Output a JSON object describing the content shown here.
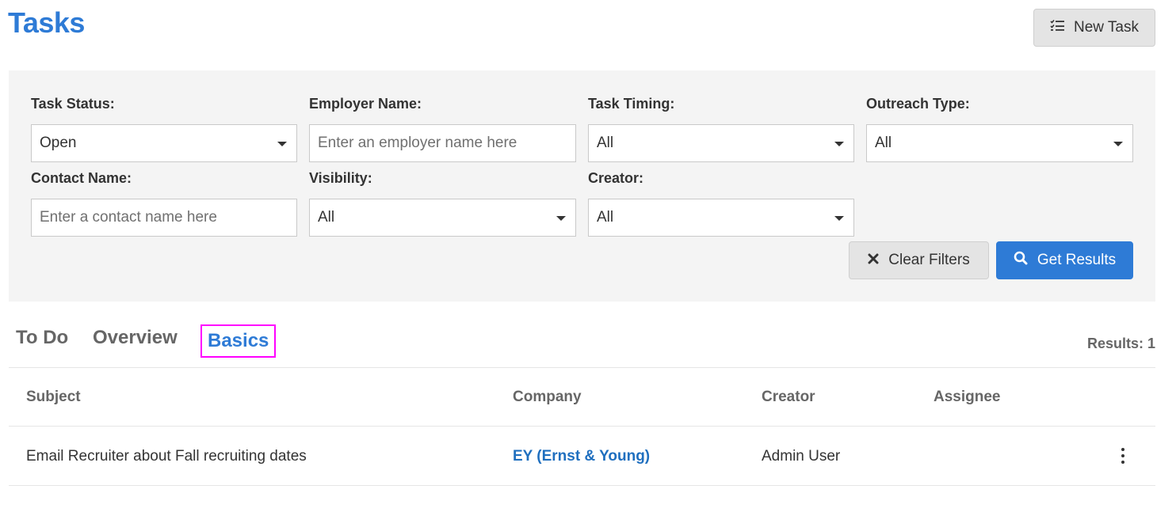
{
  "header": {
    "title": "Tasks",
    "new_task_label": "New Task"
  },
  "filters": {
    "task_status": {
      "label": "Task Status:",
      "value": "Open"
    },
    "employer_name": {
      "label": "Employer Name:",
      "placeholder": "Enter an employer name here"
    },
    "task_timing": {
      "label": "Task Timing:",
      "value": "All"
    },
    "outreach_type": {
      "label": "Outreach Type:",
      "value": "All"
    },
    "contact_name": {
      "label": "Contact Name:",
      "placeholder": "Enter a contact name here"
    },
    "visibility": {
      "label": "Visibility:",
      "value": "All"
    },
    "creator": {
      "label": "Creator:",
      "value": "All"
    },
    "clear_label": "Clear Filters",
    "get_results_label": "Get Results"
  },
  "tabs": [
    {
      "label": "To Do",
      "active": false
    },
    {
      "label": "Overview",
      "active": false
    },
    {
      "label": "Basics",
      "active": true
    }
  ],
  "results": {
    "count_text": "Results: 1"
  },
  "table": {
    "columns": [
      "Subject",
      "Company",
      "Creator",
      "Assignee"
    ],
    "rows": [
      {
        "subject": "Email Recruiter about Fall recruiting dates",
        "company": "EY (Ernst & Young)",
        "creator": "Admin User",
        "assignee": ""
      }
    ]
  },
  "colors": {
    "accent": "#2e7bd6",
    "link": "#1f6fbf",
    "highlight": "#ff00ff",
    "panel": "#f4f4f4"
  },
  "icons": {
    "new_task": "task-list-icon",
    "clear": "close-icon",
    "get_results": "search-icon",
    "row_menu": "more-vertical-icon"
  }
}
